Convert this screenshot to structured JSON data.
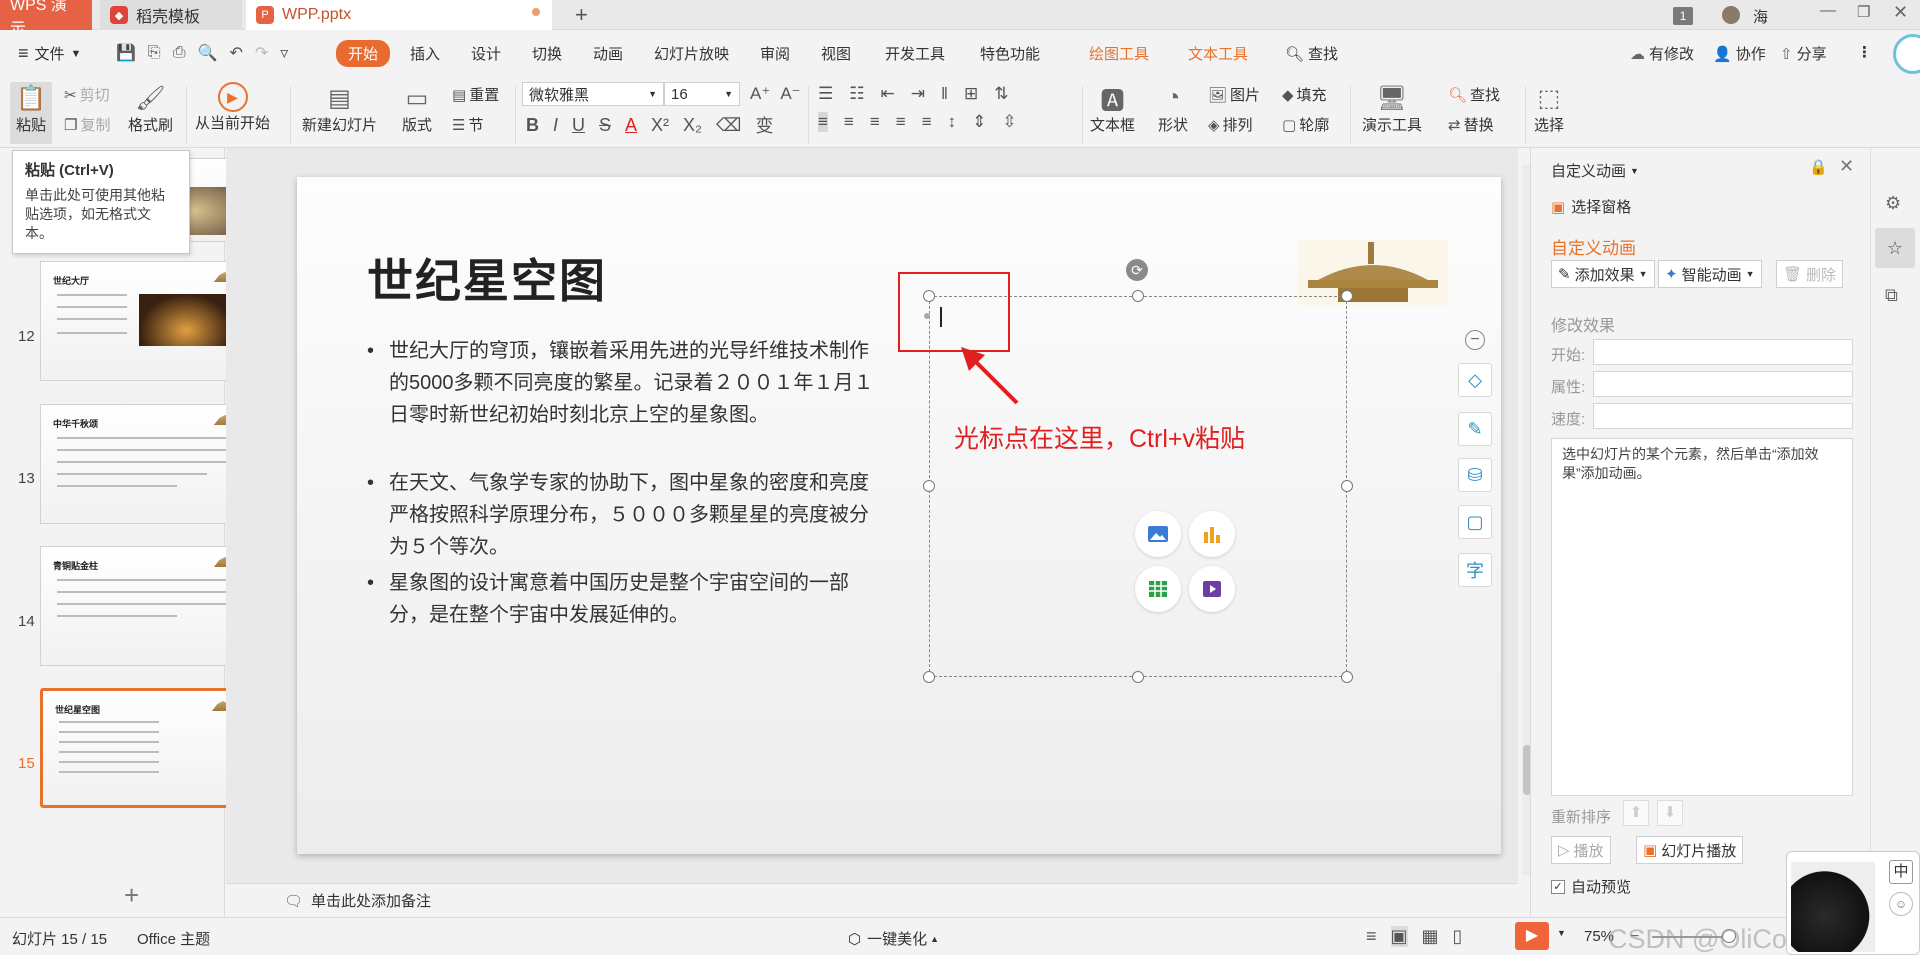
{
  "titlebar": {
    "wps_tab": "WPS 演示",
    "daoke_tab": "稻壳模板",
    "doc_tab": "WPP.pptx",
    "badge": "1",
    "user": "海"
  },
  "menu": {
    "file": "文件",
    "items": [
      "开始",
      "插入",
      "设计",
      "切换",
      "动画",
      "幻灯片放映",
      "审阅",
      "视图",
      "开发工具",
      "特色功能"
    ],
    "context": [
      "绘图工具",
      "文本工具"
    ],
    "search": "查找",
    "right": [
      "有修改",
      "协作",
      "分享"
    ]
  },
  "ribbon": {
    "paste": "粘贴",
    "cut": "剪切",
    "copy": "复制",
    "format_painter": "格式刷",
    "from_current": "从当前开始",
    "new_slide": "新建幻灯片",
    "layout": "版式",
    "reset": "重置",
    "section": "节",
    "font_name": "微软雅黑",
    "font_size": "16",
    "textbox": "文本框",
    "shape": "形状",
    "picture": "图片",
    "fill": "填充",
    "arrange": "排列",
    "outline": "轮廓",
    "present_tools": "演示工具",
    "find": "查找",
    "replace": "替换",
    "select": "选择"
  },
  "tooltip": {
    "title": "粘贴 (Ctrl+V)",
    "body": "单击此处可使用其他粘贴选项，如无格式文本。"
  },
  "slides": [
    {
      "num": "12",
      "title": "世纪大厅"
    },
    {
      "num": "13",
      "title": "中华千秋颂"
    },
    {
      "num": "14",
      "title": "青铜贴金柱"
    },
    {
      "num": "15",
      "title": "世纪星空图"
    }
  ],
  "slide": {
    "title": "世纪星空图",
    "bullets": [
      "世纪大厅的穹顶，镶嵌着采用先进的光导纤维技术制作的5000多颗不同亮度的繁星。记录着２００１年１月１日零时新世纪初始时刻北京上空的星象图。",
      "在天文、气象学专家的协助下，图中星象的密度和亮度严格按照科学原理分布，５０００多颗星星的亮度被分为５个等次。",
      "星象图的设计寓意着中国历史是整个宇宙空间的一部分，是在整个宇宙中发展延伸的。"
    ],
    "annotation": "光标点在这里，Ctrl+v粘贴"
  },
  "right_panel": {
    "header": "自定义动画",
    "selection_pane": "选择窗格",
    "section_title": "自定义动画",
    "add_effect": "添加效果",
    "smart_anim": "智能动画",
    "delete": "删除",
    "modify": "修改效果",
    "start": "开始:",
    "property": "属性:",
    "speed": "速度:",
    "hint": "选中幻灯片的某个元素，然后单击“添加效果”添加动画。",
    "reorder": "重新排序",
    "play": "播放",
    "slideshow": "幻灯片播放",
    "autopreview": "自动预览"
  },
  "notes_placeholder": "单击此处添加备注",
  "status": {
    "slide_count": "幻灯片 15 / 15",
    "theme": "Office 主题",
    "beautify": "一键美化",
    "zoom": "75%",
    "watermark": "CSDN @OliCorrect",
    "ime": "中"
  },
  "colors": {
    "accent": "#e8722a",
    "wps": "#e56344",
    "annotation": "#e02020"
  }
}
